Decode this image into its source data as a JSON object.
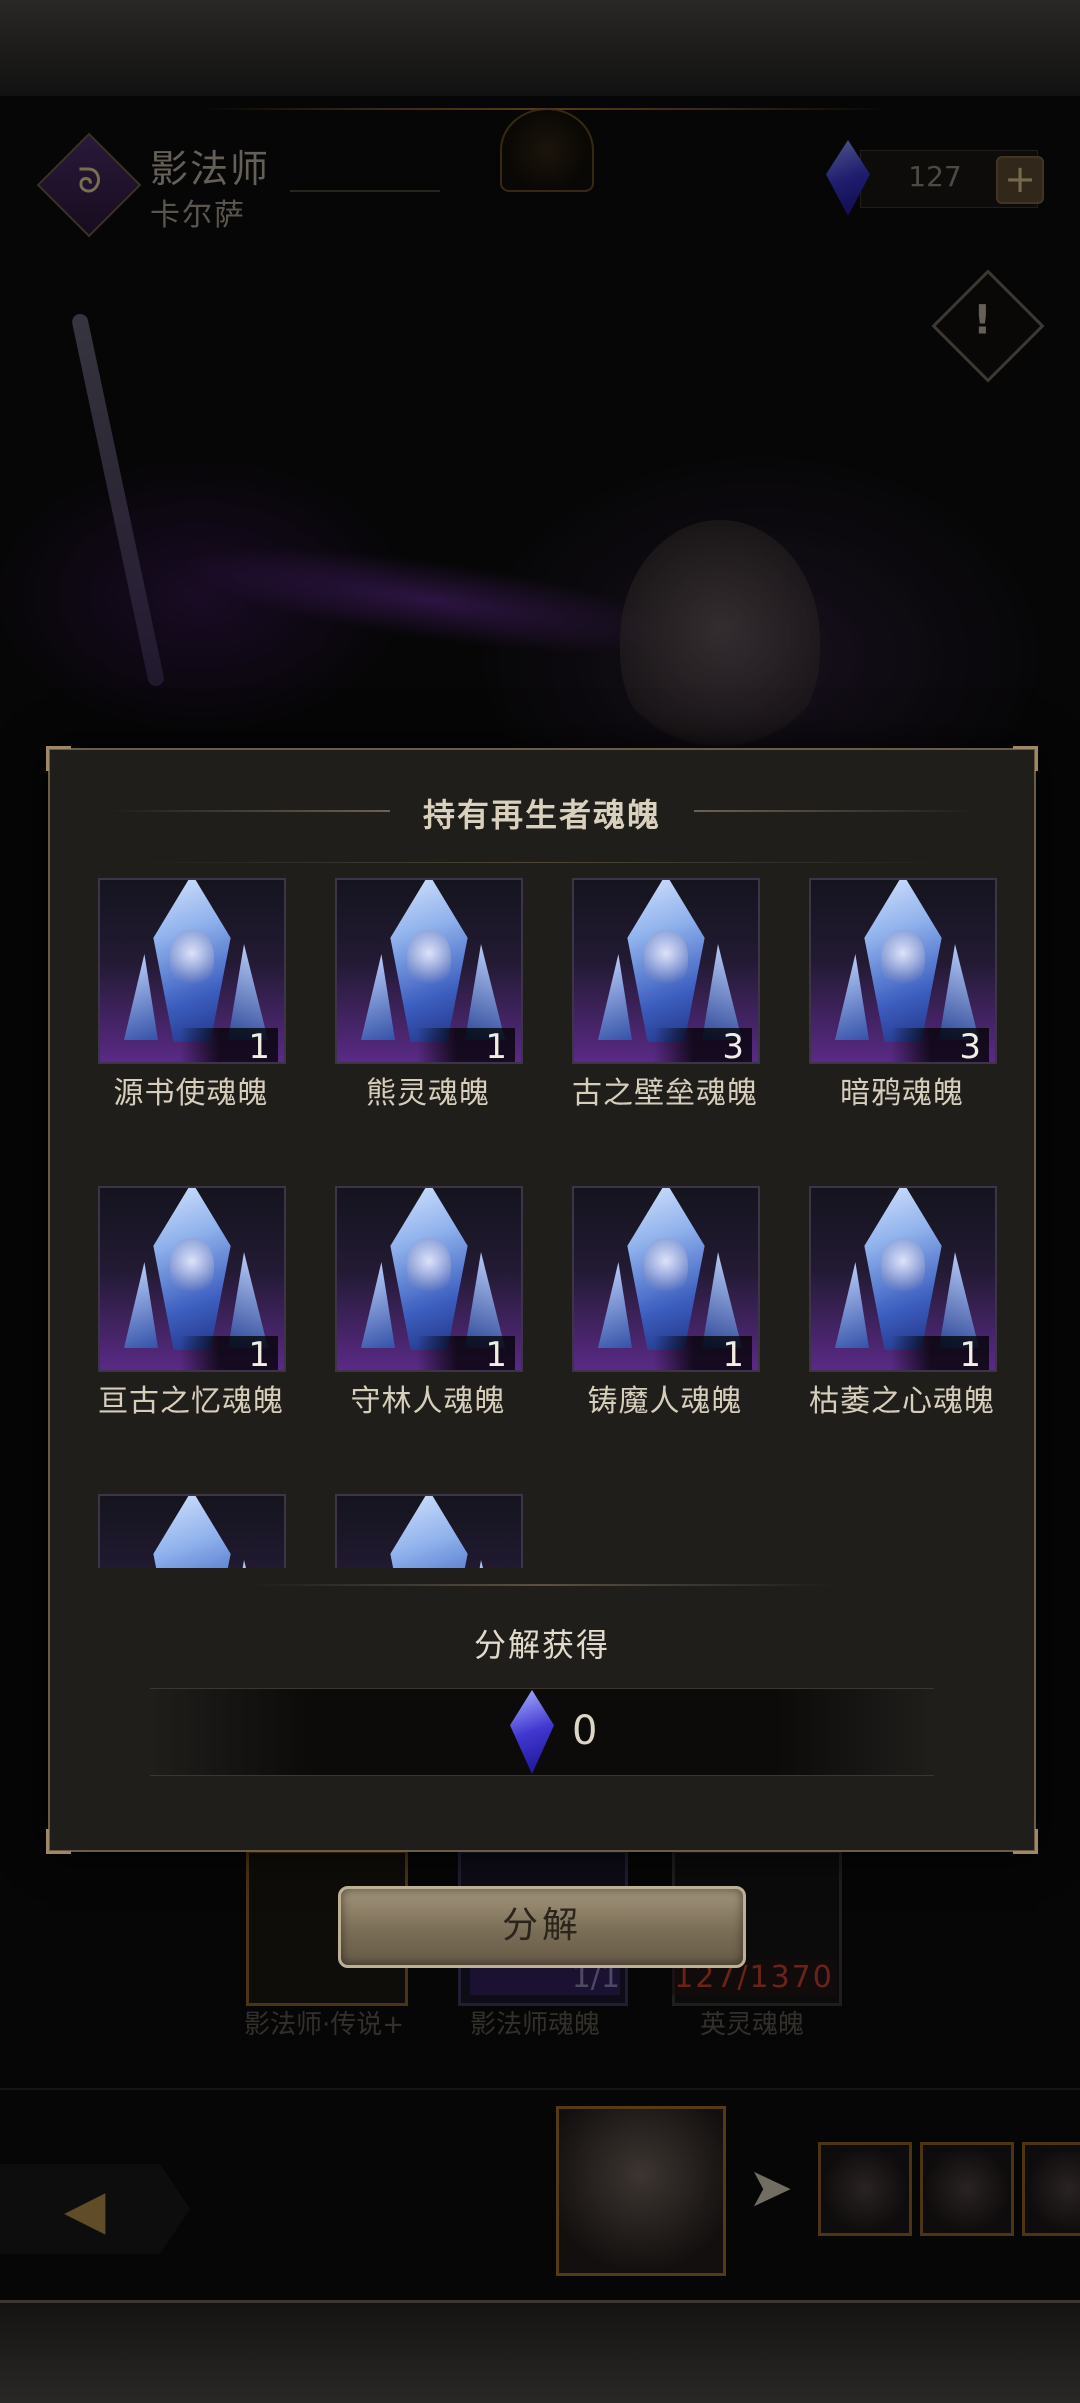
{
  "header": {
    "class_name": "影法师",
    "hero_name": "卡尔萨",
    "currency": {
      "value": "127",
      "plus_label": "+",
      "gem_color": "#3b36c9"
    },
    "info_label": "!"
  },
  "modal": {
    "title": "持有再生者魂魄",
    "souls": [
      {
        "name": "源书使魂魄",
        "count": "1"
      },
      {
        "name": "熊灵魂魄",
        "count": "1"
      },
      {
        "name": "古之壁垒魂魄",
        "count": "3"
      },
      {
        "name": "暗鸦魂魄",
        "count": "3"
      },
      {
        "name": "亘古之忆魂魄",
        "count": "1"
      },
      {
        "name": "守林人魂魄",
        "count": "1"
      },
      {
        "name": "铸魔人魂魄",
        "count": "1"
      },
      {
        "name": "枯萎之心魂魄",
        "count": "1"
      }
    ],
    "decompose_label": "分解获得",
    "reward_value": "0",
    "accent_color": "#6a5c46"
  },
  "background": {
    "card1_label": "影法师·传说+",
    "card2_count": "1/1",
    "card2_label": "影法师魂魄",
    "card3_count": "127/1370",
    "card3_label": "英灵魂魄"
  },
  "decompose_button_label": "分解",
  "nav": {
    "back_icon": "back-arrow-icon",
    "next_icon": "next-arrow-icon"
  }
}
